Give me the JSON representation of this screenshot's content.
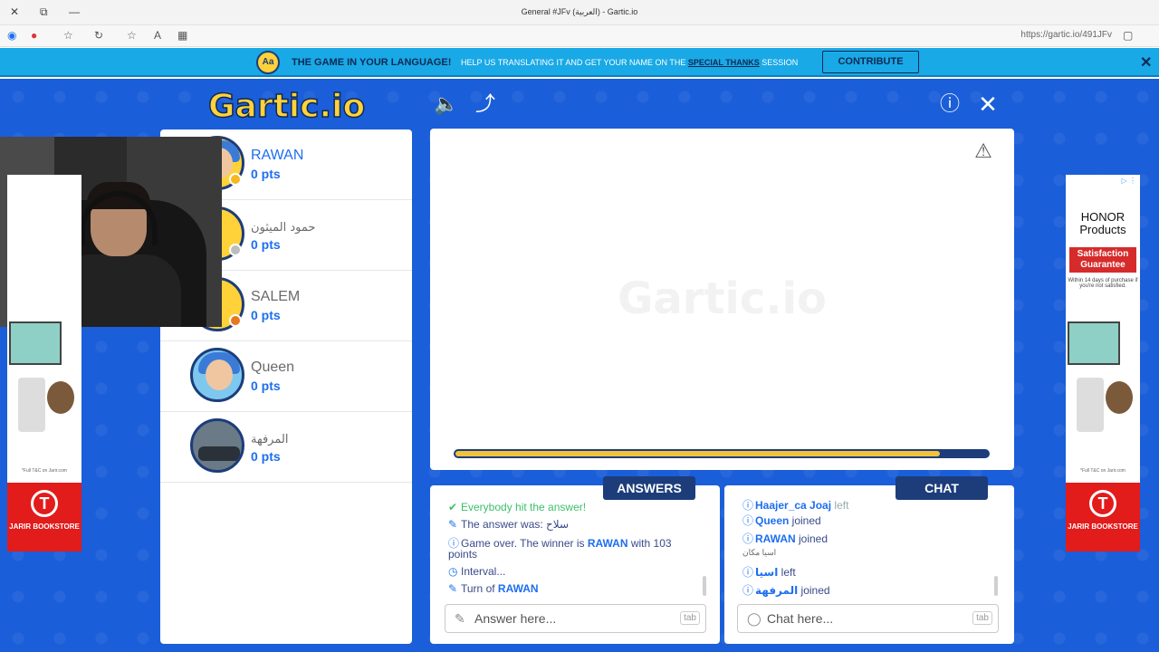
{
  "window": {
    "title": "General #JFv (العربية) - Gartic.io",
    "url": "https://gartic.io/491JFv"
  },
  "banner": {
    "headline": "THE GAME IN YOUR LANGUAGE!",
    "text_before": "HELP US TRANSLATING IT AND GET YOUR NAME ON THE ",
    "link": "SPECIAL THANKS",
    "text_after": " SESSION",
    "button": "CONTRIBUTE",
    "badge": "Aa"
  },
  "game": {
    "logo": "Gartic.io",
    "watermark": "Gartic.io",
    "timer_fraction": 0.91
  },
  "players": [
    {
      "name": "RAWAN",
      "points": "0 pts",
      "status_color": "#f5b820"
    },
    {
      "name": "حمود الميثون",
      "points": "0 pts",
      "status_color": "#bdbdbd"
    },
    {
      "name": "SALEM",
      "points": "0 pts",
      "status_color": "#e8781e"
    },
    {
      "name": "Queen",
      "points": "0 pts"
    },
    {
      "name": "المرفهة",
      "points": "0 pts"
    }
  ],
  "answers": {
    "label": "ANSWERS",
    "messages": [
      {
        "icon": "check",
        "text": "Everybody hit the answer!"
      },
      {
        "icon": "pencil",
        "text": "The answer was: ",
        "bold": "سلاح"
      },
      {
        "icon": "info",
        "text": "Game over. The winner is ",
        "bold": "RAWAN",
        "suffix": " with 103"
      },
      {
        "icon": "",
        "text": "points"
      },
      {
        "icon": "clock",
        "text": "Interval..."
      },
      {
        "icon": "pencil",
        "text": "Turn of ",
        "bold": "RAWAN"
      }
    ],
    "placeholder": "Answer here...",
    "tab": "tab"
  },
  "chat": {
    "label": "CHAT",
    "messages": [
      {
        "icon": "info",
        "bold": "Haajer_ca Joaj",
        "text": " left"
      },
      {
        "icon": "info",
        "bold": "Queen",
        "text": " joined"
      },
      {
        "icon": "info",
        "bold": "RAWAN",
        "text": " joined"
      },
      {
        "icon": "",
        "text": "اسيا مكان"
      },
      {
        "icon": "info",
        "bold": "اسيا",
        "text": " left"
      },
      {
        "icon": "info",
        "bold": "المرفهة",
        "text": " joined"
      }
    ],
    "placeholder": "Chat here...",
    "tab": "tab"
  },
  "ads": {
    "left": {
      "fineprint": "*Full T&C on Jarir.com",
      "store": "JARIR BOOKSTORE"
    },
    "right": {
      "title": "HONOR Products",
      "badge_line1": "Satisfaction",
      "badge_line2": "Guarantee",
      "small": "Within 14 days of purchase if you're not satisfied.",
      "fineprint": "*Full T&C on Jarir.com",
      "store": "JARIR BOOKSTORE"
    }
  },
  "colors": {
    "background": "#1b5ed9",
    "accent": "#1d6ef0",
    "navy": "#1c3d7a",
    "timer": "#f2c33a"
  }
}
